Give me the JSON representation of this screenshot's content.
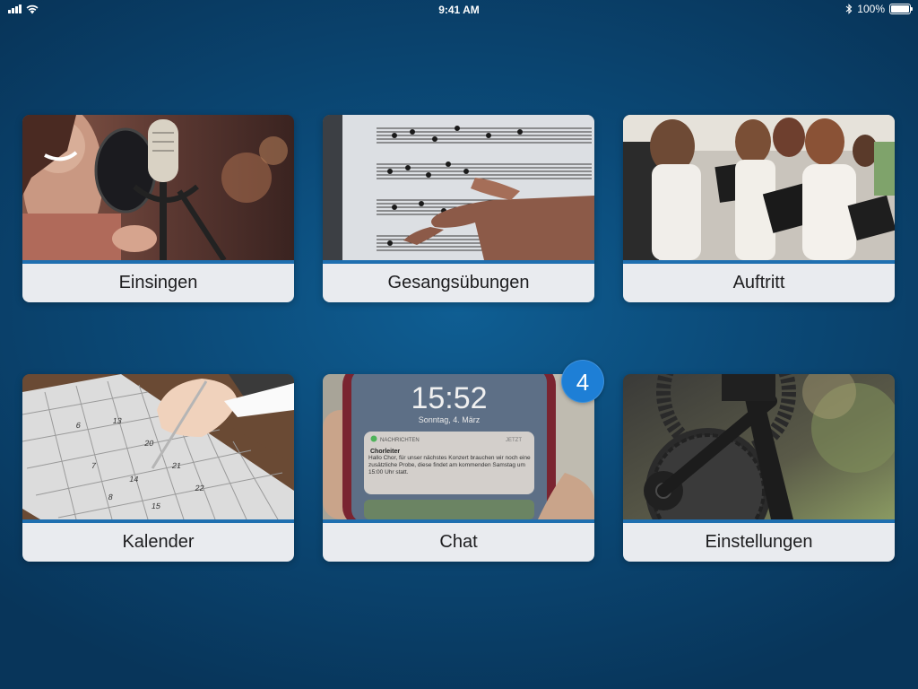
{
  "status_bar": {
    "time": "9:41 AM",
    "battery": "100%",
    "icons": [
      "signal-icon",
      "wifi-icon",
      "bluetooth-icon",
      "battery-icon"
    ]
  },
  "menu": {
    "tiles": [
      {
        "label": "Einsingen",
        "image": "singer-microphone-image"
      },
      {
        "label": "Gesangsübungen",
        "image": "sheet-music-image"
      },
      {
        "label": "Auftritt",
        "image": "choir-performance-image"
      },
      {
        "label": "Kalender",
        "image": "calendar-writing-image"
      },
      {
        "label": "Chat",
        "image": "phone-notification-image",
        "badge": "4"
      },
      {
        "label": "Einstellungen",
        "image": "gears-image"
      }
    ]
  },
  "chat_image_screen": {
    "time": "15:52",
    "date": "Sonntag, 4. März",
    "app": "NACHRICHTEN",
    "when": "JETZT",
    "sender": "Chorleiter",
    "message": "Hallo Chor, für unser nächstes Konzert brauchen wir noch eine zusätzliche Probe, diese findet am kommenden Samstag um 15:00 Uhr statt."
  },
  "colors": {
    "accent": "#1f6fb0",
    "badge": "#1e7fd6",
    "label_background": "#e9ebef"
  }
}
